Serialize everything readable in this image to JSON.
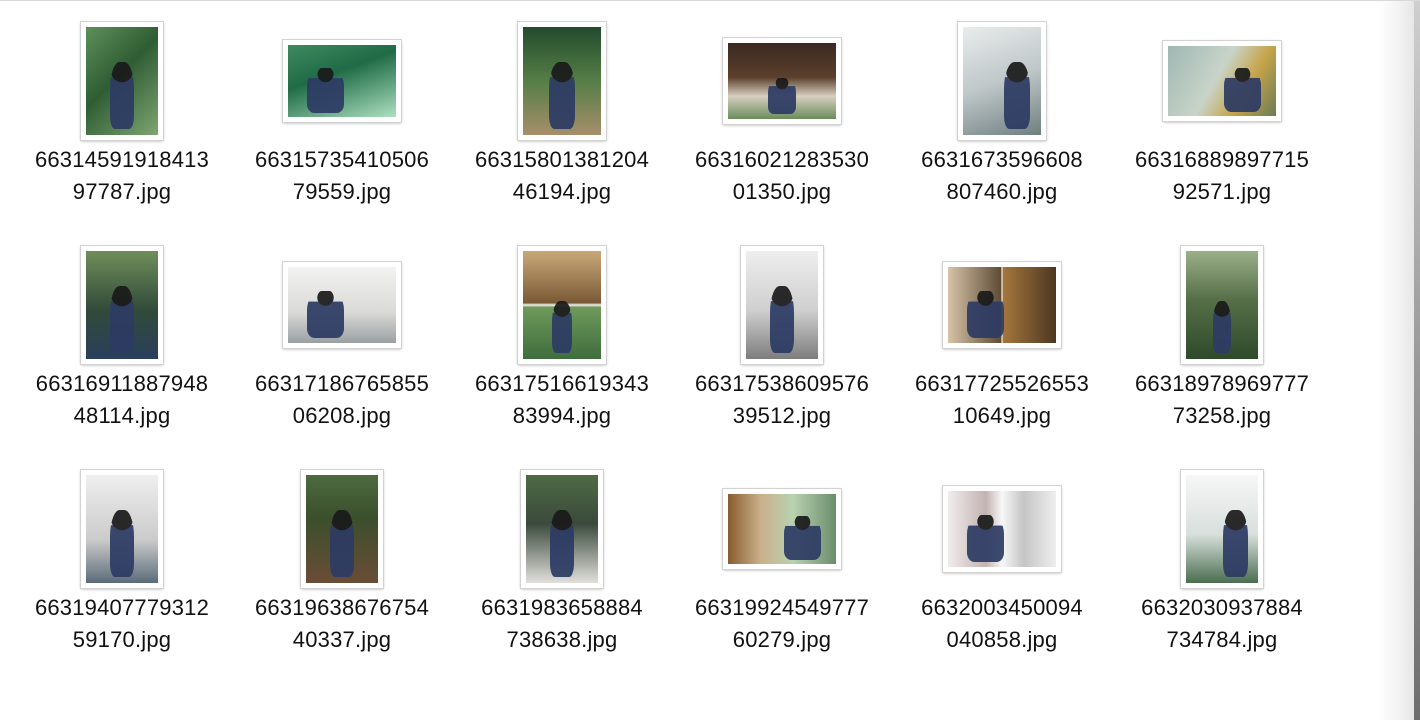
{
  "files": [
    {
      "name_line1": "66314591918413",
      "name_line2": "97787.jpg",
      "orientation": "portrait",
      "palette": "ph-green",
      "figure": "center"
    },
    {
      "name_line1": "66315735410506",
      "name_line2": "79559.jpg",
      "orientation": "landscape",
      "palette": "ph-teal",
      "figure": "left"
    },
    {
      "name_line1": "66315801381204",
      "name_line2": "46194.jpg",
      "orientation": "portrait-wide",
      "palette": "ph-dark",
      "figure": "center"
    },
    {
      "name_line1": "66316021283530",
      "name_line2": "01350.jpg",
      "orientation": "land-wide",
      "palette": "ph-cafe",
      "figure": "small"
    },
    {
      "name_line1": "6631673596608",
      "name_line2": "807460.jpg",
      "orientation": "portrait-wide",
      "palette": "ph-pale",
      "figure": "right"
    },
    {
      "name_line1": "66316889897715",
      "name_line2": "92571.jpg",
      "orientation": "landscape-short",
      "palette": "ph-bloom",
      "figure": "right"
    },
    {
      "name_line1": "66316911887948",
      "name_line2": "48114.jpg",
      "orientation": "portrait",
      "palette": "ph-mossy",
      "figure": "center"
    },
    {
      "name_line1": "66317186765855",
      "name_line2": "06208.jpg",
      "orientation": "land-wide",
      "palette": "ph-white",
      "figure": "left"
    },
    {
      "name_line1": "66317516619343",
      "name_line2": "83994.jpg",
      "orientation": "portrait-wide",
      "palette": "ph-split",
      "figure": "small"
    },
    {
      "name_line1": "66317538609576",
      "name_line2": "39512.jpg",
      "orientation": "portrait",
      "palette": "ph-pillow",
      "figure": "center"
    },
    {
      "name_line1": "66317725526553",
      "name_line2": "10649.jpg",
      "orientation": "land-wide",
      "palette": "ph-diptych",
      "figure": "left"
    },
    {
      "name_line1": "66318978969777",
      "name_line2": "73258.jpg",
      "orientation": "portrait",
      "palette": "ph-garden",
      "figure": "small"
    },
    {
      "name_line1": "66319407779312",
      "name_line2": "59170.jpg",
      "orientation": "portrait",
      "palette": "ph-soft",
      "figure": "center"
    },
    {
      "name_line1": "66319638676754",
      "name_line2": "40337.jpg",
      "orientation": "portrait",
      "palette": "ph-wood",
      "figure": "center"
    },
    {
      "name_line1": "6631983658884",
      "name_line2": "738638.jpg",
      "orientation": "portrait",
      "palette": "ph-grey",
      "figure": "center"
    },
    {
      "name_line1": "66319924549777",
      "name_line2": "60279.jpg",
      "orientation": "landscape-short",
      "palette": "ph-blur",
      "figure": "right"
    },
    {
      "name_line1": "6632003450094",
      "name_line2": "040858.jpg",
      "orientation": "land-wide",
      "palette": "ph-gallery",
      "figure": "left"
    },
    {
      "name_line1": "6632030937884",
      "name_line2": "734784.jpg",
      "orientation": "portrait",
      "palette": "ph-sign",
      "figure": "right"
    }
  ]
}
